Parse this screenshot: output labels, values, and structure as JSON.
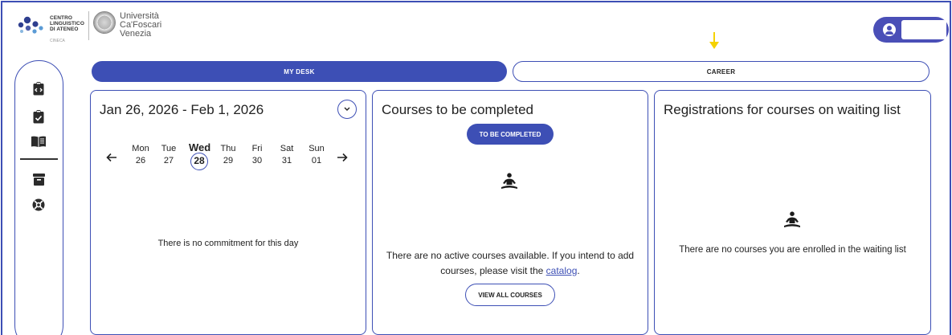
{
  "header": {
    "cla_logo": {
      "lines": [
        "CENTRO",
        "LINGUISTICO",
        "DI ATENEO"
      ],
      "sub": "CINECA"
    },
    "university_logo": {
      "lines": [
        "Università",
        "Ca'Foscari",
        "Venezia"
      ]
    },
    "user_icon": "user-circle-icon",
    "highlight_arrow_color": "#f5d200"
  },
  "sidebar": {
    "icons": [
      "code-clipboard-icon",
      "clipboard-check-icon",
      "book-open-icon",
      "archive-box-icon",
      "lifebuoy-icon"
    ]
  },
  "tabs": [
    {
      "label": "MY DESK",
      "active": true
    },
    {
      "label": "CAREER",
      "active": false
    }
  ],
  "calendar": {
    "range": "Jan 26, 2026 - Feb 1, 2026",
    "prev_icon": "arrow-left-icon",
    "next_icon": "arrow-right-icon",
    "days": [
      {
        "name": "Mon",
        "date": "26"
      },
      {
        "name": "Tue",
        "date": "27"
      },
      {
        "name": "Wed",
        "date": "28",
        "selected": true
      },
      {
        "name": "Thu",
        "date": "29"
      },
      {
        "name": "Fri",
        "date": "30"
      },
      {
        "name": "Sat",
        "date": "31"
      },
      {
        "name": "Sun",
        "date": "01"
      }
    ],
    "empty": "There is no commitment for this day"
  },
  "courses": {
    "title": "Courses to be completed",
    "button": "TO BE COMPLETED",
    "empty_before": "There are no active courses available. If you intend to add courses, please visit the ",
    "empty_link": "catalog",
    "empty_after": ".",
    "view_all": "VIEW ALL COURSES"
  },
  "waiting": {
    "title": "Registrations for courses on waiting list",
    "empty": "There are no courses you are enrolled in the waiting list"
  },
  "colors": {
    "accent": "#3d4fb5"
  }
}
